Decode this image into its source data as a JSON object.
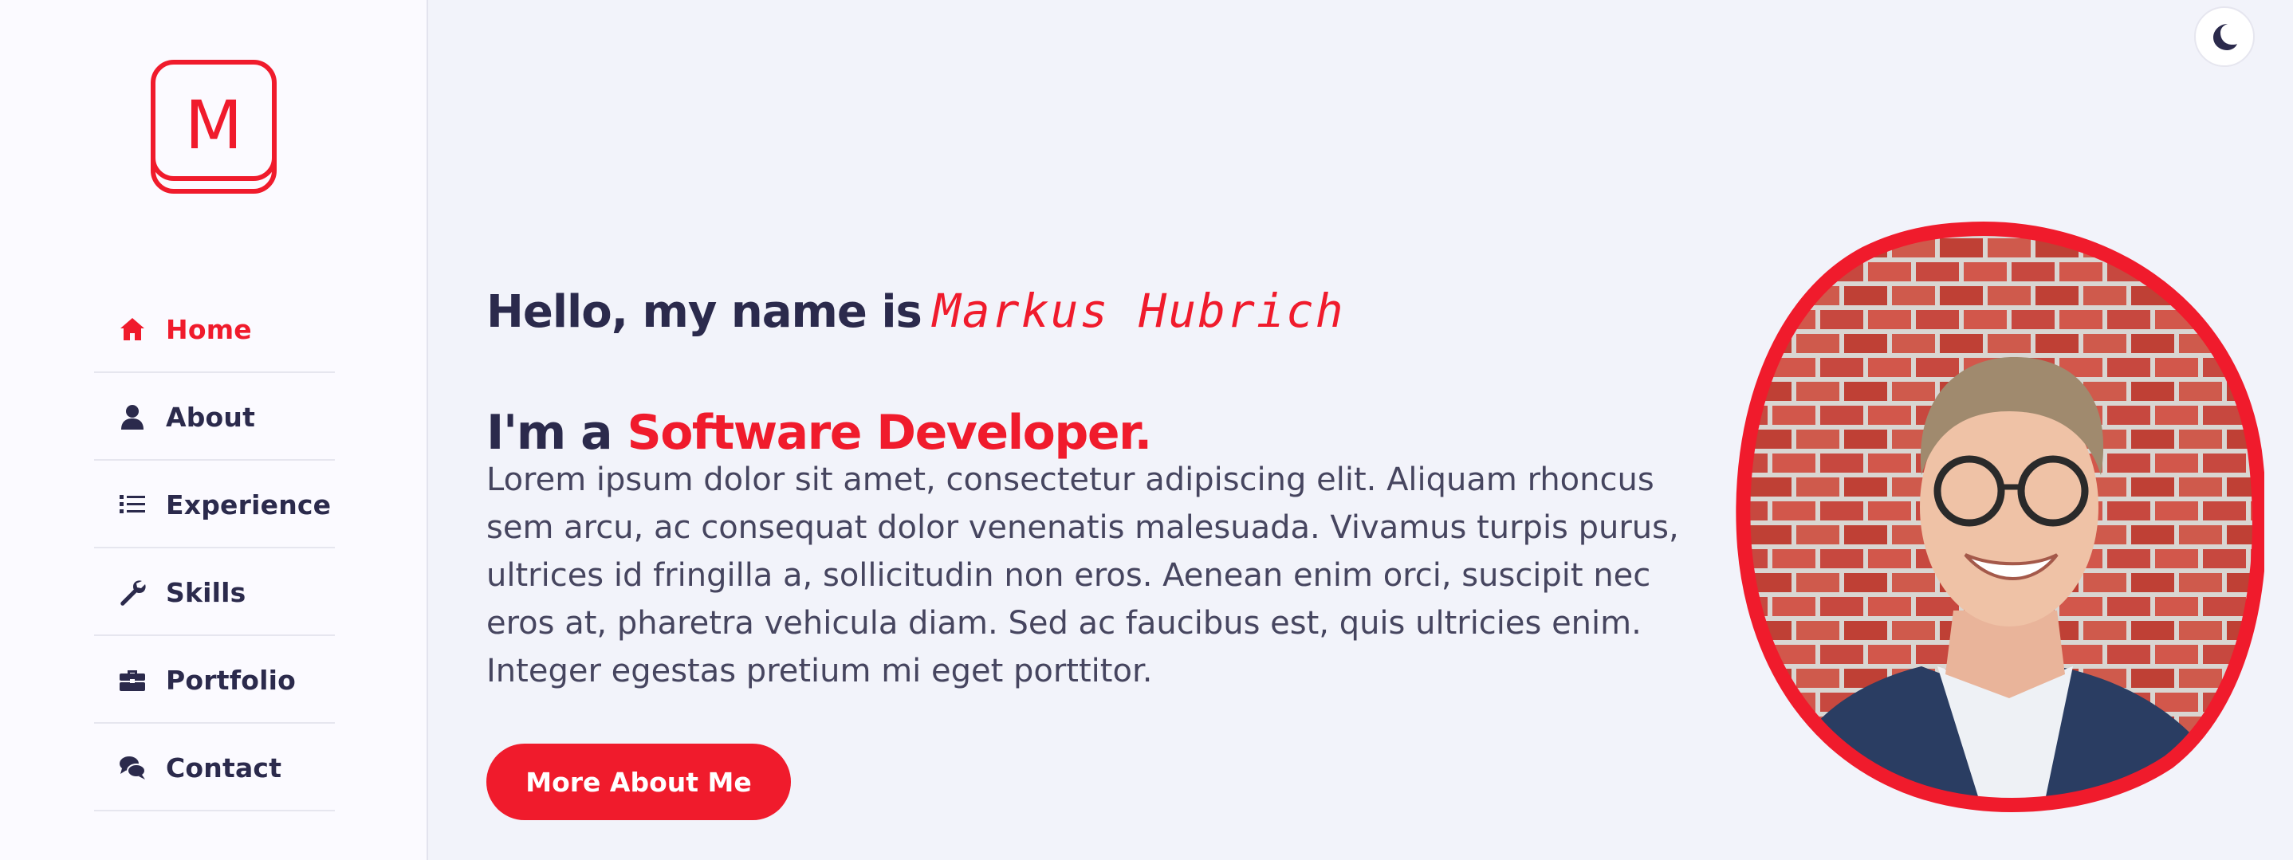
{
  "app": {
    "logo_letter": "M",
    "accent_color": "#f01b2c",
    "text_color": "#2b2a4c"
  },
  "sidebar": {
    "items": [
      {
        "label": "Home",
        "icon": "home-icon",
        "active": true
      },
      {
        "label": "About",
        "icon": "user-icon",
        "active": false
      },
      {
        "label": "Experience",
        "icon": "list-icon",
        "active": false
      },
      {
        "label": "Skills",
        "icon": "wrench-icon",
        "active": false
      },
      {
        "label": "Portfolio",
        "icon": "briefcase-icon",
        "active": false
      },
      {
        "label": "Contact",
        "icon": "comments-icon",
        "active": false
      }
    ]
  },
  "header": {
    "theme_toggle_icon": "moon-icon"
  },
  "hero": {
    "greeting": "Hello, my name is",
    "name": "Markus Hubrich",
    "role_prefix": "I'm a",
    "role": "Software Developer.",
    "bio": "Lorem ipsum dolor sit amet, consectetur adipiscing elit. Aliquam rhoncus sem arcu, ac consequat dolor venenatis malesuada. Vivamus turpis purus, ultrices id fringilla a, sollicitudin non eros. Aenean enim orci, suscipit nec eros at, pharetra vehicula diam. Sed ac faucibus est, quis ultricies enim. Integer egestas pretium mi eget porttitor.",
    "cta_label": "More About Me"
  }
}
